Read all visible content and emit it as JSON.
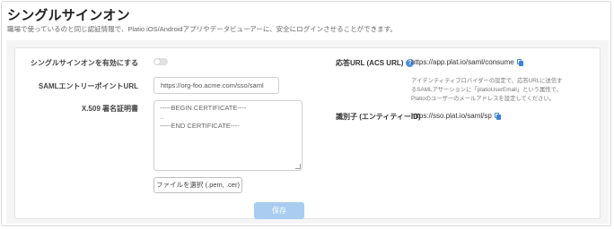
{
  "page": {
    "title": "シングルサインオン",
    "subtitle": "職場で使っているのと同じ認証情報で、Platio iOS/Androidアプリやデータビューアーに、安全にログインさせることができます。"
  },
  "form": {
    "enable_label": "シングルサインオンを有効にする",
    "enable_value": false,
    "saml_url_label": "SAMLエントリーポイントURL",
    "saml_url_value": "https://org-foo.acme.com/sso/saml",
    "cert_label": "X.509 署名証明書",
    "cert_lines": [
      "-----BEGIN CERTIFICATE----",
      "..",
      "-----END CERTIFICATE----"
    ],
    "file_button": "ファイルを選択 (.pem, .cer)",
    "save_button": "保存"
  },
  "info": {
    "acs_label": "応答URL (ACS URL)",
    "acs_value": "https://app.plat.io/saml/consume",
    "acs_note": [
      "アイデンティティプロバイダーの設定で、応答URLに送信す",
      "るSAMLアサーションに「platioUserEmail」という属性で、",
      "Platioのユーザーのメールアドレスを設定してください。"
    ],
    "entity_label": "識別子 (エンティティーID)",
    "entity_value": "https://sso.plat.io/saml/sp"
  },
  "colors": {
    "accent": "#4a90e2",
    "save_button_disabled": "#a9cdf0"
  }
}
